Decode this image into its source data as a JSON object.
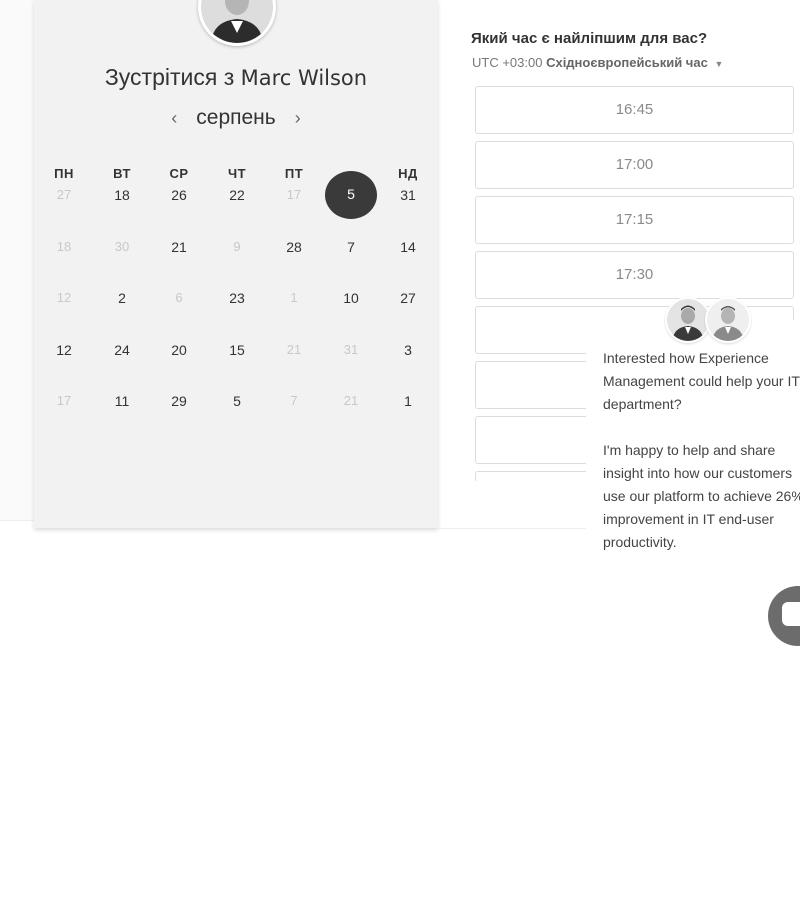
{
  "meeting": {
    "title_prefix": "Зустрітися з",
    "host_name": "Marc Wilson"
  },
  "calendar": {
    "month_label": "серпень",
    "prev_icon": "chevron-left-icon",
    "next_icon": "chevron-right-icon",
    "weekdays": [
      "ПН",
      "ВТ",
      "СР",
      "ЧТ",
      "ПТ",
      "",
      "НД"
    ],
    "weeks": [
      [
        {
          "d": "27",
          "on": false
        },
        {
          "d": "18",
          "on": true
        },
        {
          "d": "26",
          "on": true
        },
        {
          "d": "22",
          "on": true
        },
        {
          "d": "17",
          "on": false
        },
        {
          "d": "5",
          "on": true,
          "selected": true
        },
        {
          "d": "31",
          "on": true
        }
      ],
      [
        {
          "d": "18",
          "on": false
        },
        {
          "d": "30",
          "on": false
        },
        {
          "d": "21",
          "on": true
        },
        {
          "d": "9",
          "on": false
        },
        {
          "d": "28",
          "on": true
        },
        {
          "d": "7",
          "on": true
        },
        {
          "d": "14",
          "on": true
        }
      ],
      [
        {
          "d": "12",
          "on": false
        },
        {
          "d": "2",
          "on": true
        },
        {
          "d": "6",
          "on": false
        },
        {
          "d": "23",
          "on": true
        },
        {
          "d": "1",
          "on": false
        },
        {
          "d": "10",
          "on": true
        },
        {
          "d": "27",
          "on": true
        }
      ],
      [
        {
          "d": "12",
          "on": true
        },
        {
          "d": "24",
          "on": true
        },
        {
          "d": "20",
          "on": true
        },
        {
          "d": "15",
          "on": true
        },
        {
          "d": "21",
          "on": false
        },
        {
          "d": "31",
          "on": false
        },
        {
          "d": "3",
          "on": true
        }
      ],
      [
        {
          "d": "17",
          "on": false
        },
        {
          "d": "11",
          "on": true
        },
        {
          "d": "29",
          "on": true
        },
        {
          "d": "5",
          "on": true
        },
        {
          "d": "7",
          "on": false
        },
        {
          "d": "21",
          "on": false
        },
        {
          "d": "1",
          "on": true
        }
      ]
    ]
  },
  "schedule": {
    "question": "Який час є найліпшим для вас?",
    "timezone_offset": "UTC +03:00",
    "timezone_name": "Східноєвропейський час",
    "timezone_caret_icon": "caret-down-icon",
    "slots": [
      "16:45",
      "17:00",
      "17:15",
      "17:30",
      "",
      "",
      "",
      ""
    ]
  },
  "chat": {
    "message_1": [
      "Interested how Experience",
      "Management could help your IT",
      "department?"
    ],
    "message_2": [
      "I'm happy to help and share",
      "insight into how our customers",
      "use our platform to achieve 26%",
      "improvement in IT end-user",
      "productivity."
    ],
    "launcher_icon": "chat-bubble-icon"
  }
}
